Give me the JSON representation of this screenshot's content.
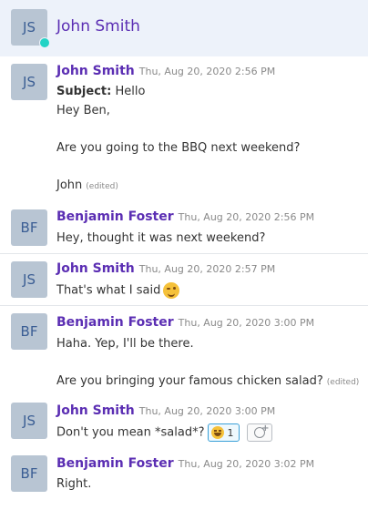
{
  "header": {
    "initials": "JS",
    "name": "John Smith",
    "status": "online"
  },
  "messages": [
    {
      "initials": "JS",
      "author": "John Smith",
      "timestamp": "Thu, Aug 20, 2020 2:56 PM",
      "subject_label": "Subject:",
      "subject": "Hello",
      "lines": [
        "Hey Ben,",
        "Are you going to the BBQ next weekend?",
        "John"
      ],
      "edited": "(edited)"
    },
    {
      "initials": "BF",
      "author": "Benjamin Foster",
      "timestamp": "Thu, Aug 20, 2020 2:56 PM",
      "lines": [
        "Hey, thought it was next weekend?"
      ]
    },
    {
      "initials": "JS",
      "author": "John Smith",
      "timestamp": "Thu, Aug 20, 2020 2:57 PM",
      "lines": [
        "That's what I said"
      ],
      "emoji": "winking-face"
    },
    {
      "initials": "BF",
      "author": "Benjamin Foster",
      "timestamp": "Thu, Aug 20, 2020 3:00 PM",
      "lines": [
        "Haha. Yep, I'll be there.",
        "Are you bringing your famous chicken salad?"
      ],
      "edited": "(edited)"
    },
    {
      "initials": "JS",
      "author": "John Smith",
      "timestamp": "Thu, Aug 20, 2020 3:00 PM",
      "lines": [
        "Don't you mean *salad*?"
      ],
      "reaction": {
        "emoji": "laughing-face",
        "count": "1"
      }
    },
    {
      "initials": "BF",
      "author": "Benjamin Foster",
      "timestamp": "Thu, Aug 20, 2020 3:02 PM",
      "lines": [
        "Right."
      ]
    }
  ],
  "colors": {
    "author": "#5b2eb3",
    "avatar_bg": "#b8c5d3",
    "presence": "#22d3c5",
    "header_bg": "#edf2fa",
    "reaction_border": "#3aa0d8"
  }
}
